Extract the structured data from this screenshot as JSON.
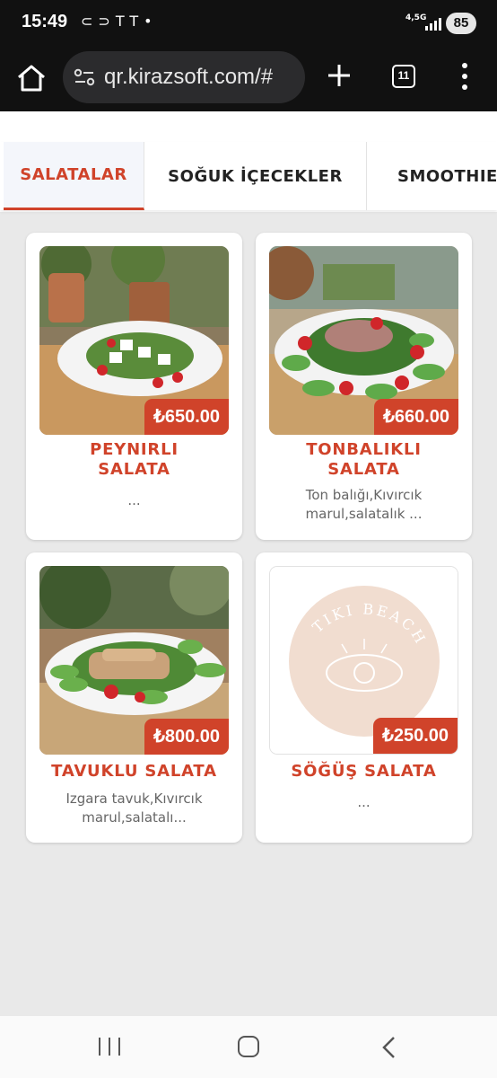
{
  "status": {
    "time": "15:49",
    "network": "4,5G",
    "battery": "85"
  },
  "browser": {
    "url": "qr.kirazsoft.com/#",
    "tab_count": "11"
  },
  "tabs": [
    {
      "label": "SALATALAR",
      "active": true
    },
    {
      "label": "SOĞUK İÇECEKLER",
      "active": false
    },
    {
      "label": "SMOOTHIE",
      "active": false
    }
  ],
  "products": [
    {
      "name_line1": "PEYNIRLI",
      "name_line2": "SALATA",
      "price": "₺650.00",
      "desc_line1": "...",
      "desc_line2": ""
    },
    {
      "name_line1": "TONBALIKLI",
      "name_line2": "SALATA",
      "price": "₺660.00",
      "desc_line1": "Ton balığı,Kıvırcık",
      "desc_line2": "marul,salatalık ..."
    },
    {
      "name_line1": "TAVUKLU SALATA",
      "name_line2": "",
      "price": "₺800.00",
      "desc_line1": "Izgara tavuk,Kıvırcık",
      "desc_line2": "marul,salatalı..."
    },
    {
      "name_line1": "SÖĞÜŞ SALATA",
      "name_line2": "",
      "price": "₺250.00",
      "desc_line1": "...",
      "desc_line2": ""
    }
  ],
  "placeholder_logo": {
    "text": "TIKI BEACH",
    "circle_color": "#f1ddd0"
  },
  "colors": {
    "accent": "#d0432a",
    "page_bg": "#e9e9e9"
  }
}
